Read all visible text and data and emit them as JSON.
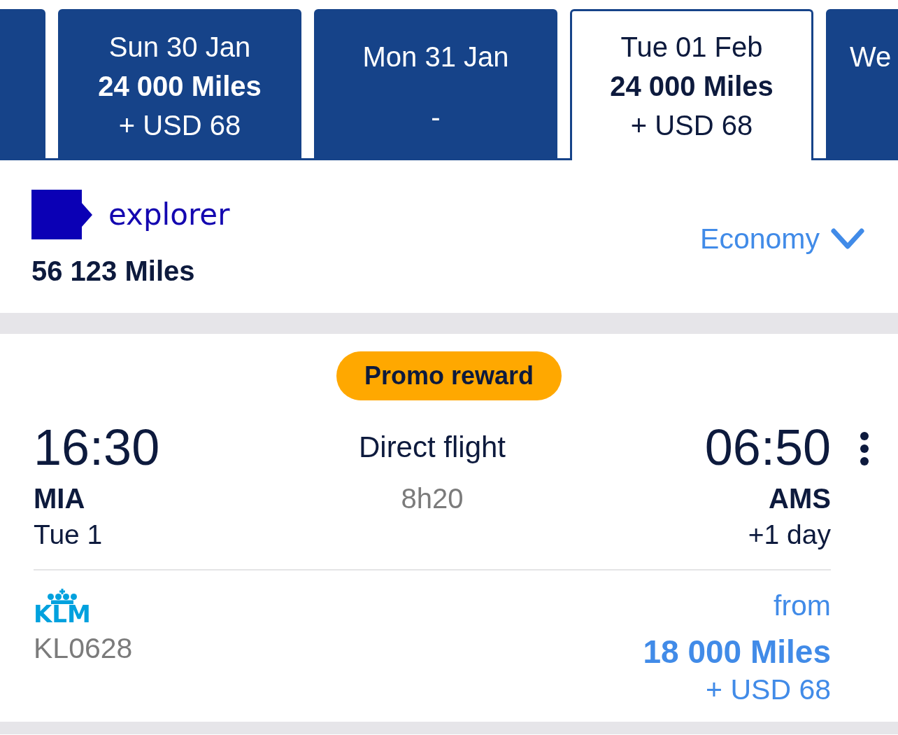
{
  "date_tabs": [
    {
      "kind": "cut",
      "selected": false
    },
    {
      "kind": "full",
      "day": "Sun 30 Jan",
      "miles": "24 000 Miles",
      "surcharge": "+ USD 68",
      "selected": false
    },
    {
      "kind": "full",
      "day": "Mon 31 Jan",
      "no_fare": "-",
      "selected": false
    },
    {
      "kind": "full",
      "day": "Tue 01 Feb",
      "miles": "24 000 Miles",
      "surcharge": "+ USD 68",
      "selected": true
    },
    {
      "kind": "cut",
      "day": "We",
      "selected": false
    }
  ],
  "membership": {
    "program": "explorer",
    "balance": "56 123 Miles"
  },
  "cabin_selector": {
    "value": "Economy"
  },
  "flight": {
    "badge": "Promo reward",
    "departure": {
      "time": "16:30",
      "airport": "MIA",
      "date": "Tue 1"
    },
    "route": {
      "type": "Direct flight",
      "duration": "8h20"
    },
    "arrival": {
      "time": "06:50",
      "airport": "AMS",
      "day_offset": "+1 day"
    },
    "airline": {
      "logo_text": "KLM",
      "flight_number": "KL0628"
    },
    "price": {
      "prefix": "from",
      "miles": "18 000 Miles",
      "surcharge": "+ USD 68"
    }
  }
}
